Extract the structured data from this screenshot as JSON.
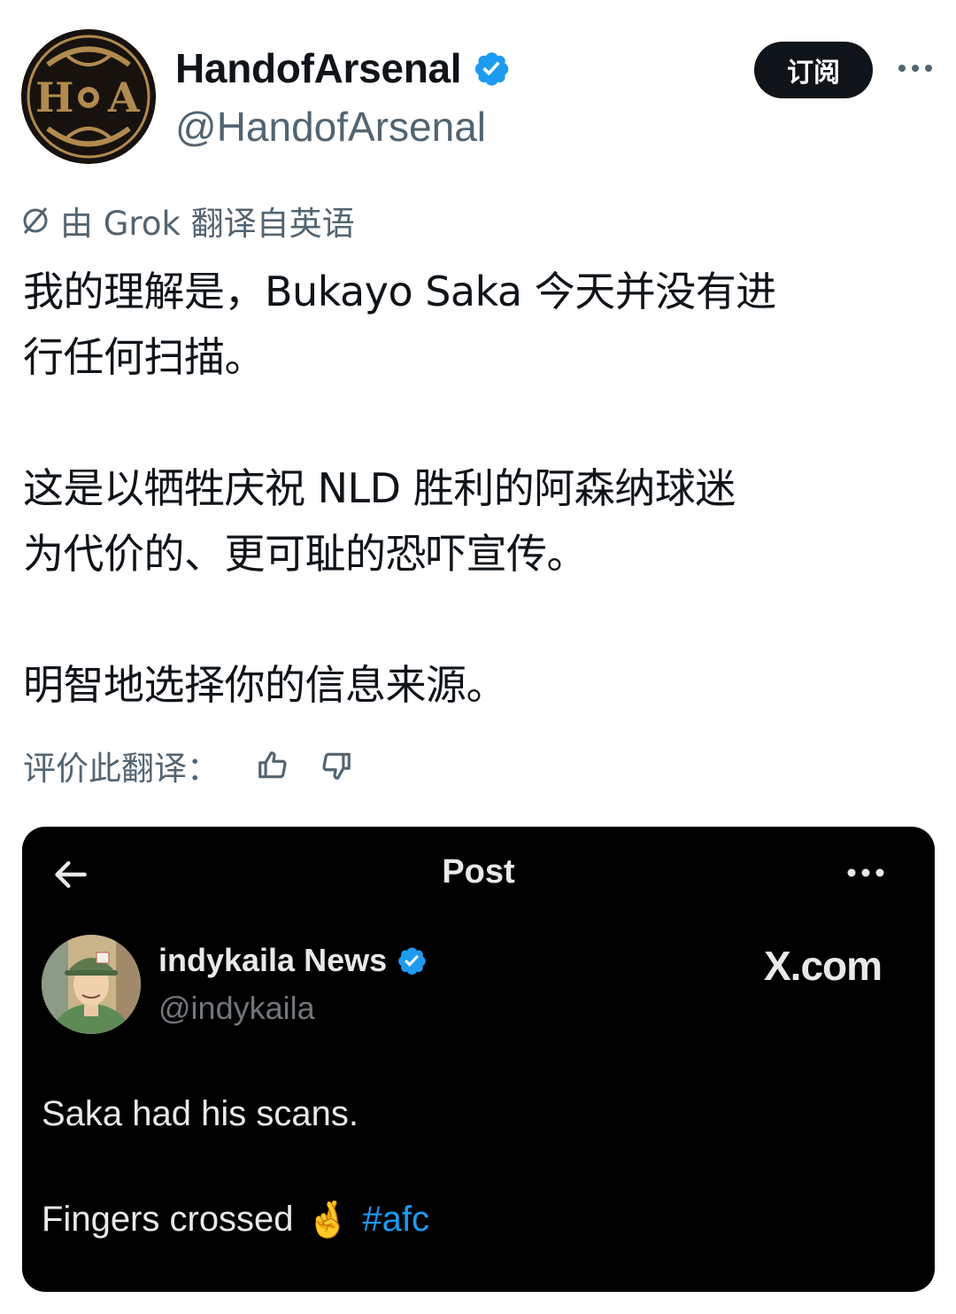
{
  "author": {
    "display_name": "HandofArsenal",
    "handle": "@HandofArsenal",
    "avatar_letters": "H A",
    "verified_icon": "verified-badge-icon"
  },
  "header": {
    "subscribe_label": "订阅",
    "more_icon": "more-horizontal-icon"
  },
  "translation": {
    "icon": "grok-icon",
    "label": "由 Grok 翻译自英语",
    "rate_label": "评价此翻译：",
    "thumbs_up_icon": "thumbs-up-icon",
    "thumbs_down_icon": "thumbs-down-icon"
  },
  "tweet": {
    "para1_line1": "我的理解是，Bukayo Saka 今天并没有进",
    "para1_line2": "行任何扫描。",
    "para2_line1": "这是以牺牲庆祝 NLD 胜利的阿森纳球迷",
    "para2_line2": "为代价的、更可耻的恐吓宣传。",
    "para3_line1": "明智地选择你的信息来源。"
  },
  "embed": {
    "title": "Post",
    "back_icon": "arrow-left-icon",
    "more_icon": "more-horizontal-icon",
    "author_name": "indykaila News",
    "author_handle": "@indykaila",
    "brand": "X.com",
    "line1": "Saka had his scans.",
    "line2_text": "Fingers crossed",
    "line2_emoji": "🤞",
    "line2_hashtag": "#afc",
    "colors": {
      "background": "#000000",
      "text": "#e7e9ea",
      "link": "#1d9bf0"
    }
  },
  "colors": {
    "verified": "#1d9bf0",
    "secondary_text": "#536471"
  }
}
